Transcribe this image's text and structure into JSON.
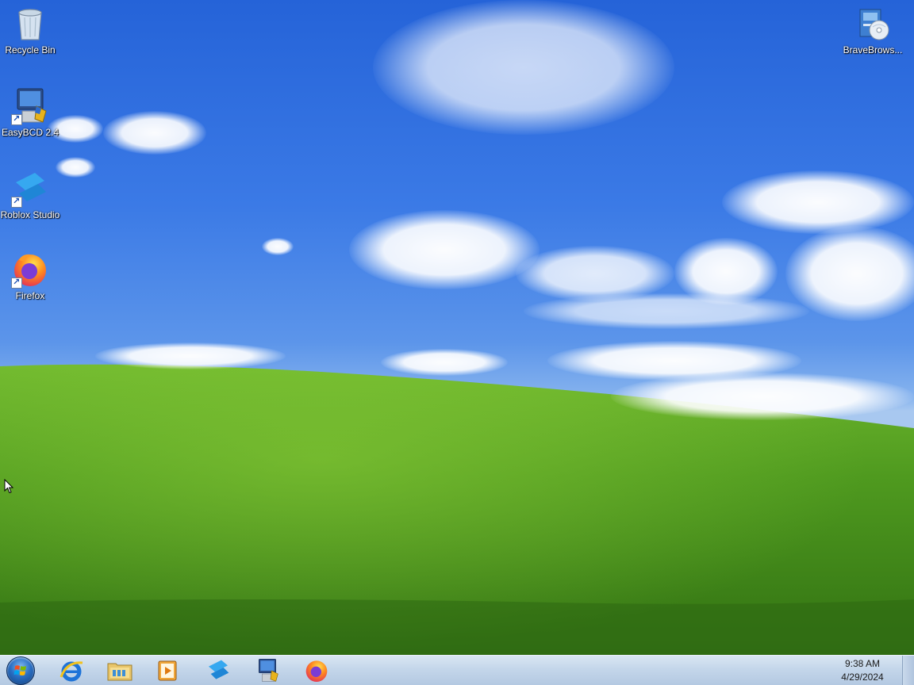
{
  "desktop": {
    "icons": [
      {
        "label": "Recycle Bin",
        "icon": "recycle-bin-icon",
        "shortcut": false
      },
      {
        "label": "EasyBCD 2.4",
        "icon": "easybcd-icon",
        "shortcut": true
      },
      {
        "label": "Roblox Studio",
        "icon": "roblox-studio-icon",
        "shortcut": true
      },
      {
        "label": "Firefox",
        "icon": "firefox-icon",
        "shortcut": true
      },
      {
        "label": "BraveBrows...",
        "icon": "brave-installer-icon",
        "shortcut": false
      }
    ]
  },
  "taskbar": {
    "pinned": [
      {
        "icon": "internet-explorer-icon"
      },
      {
        "icon": "file-explorer-icon"
      },
      {
        "icon": "media-player-icon"
      },
      {
        "icon": "roblox-studio-icon"
      },
      {
        "icon": "easybcd-icon"
      },
      {
        "icon": "firefox-icon"
      }
    ],
    "clock": {
      "time": "9:38 AM",
      "date": "4/29/2024"
    }
  },
  "colors": {
    "sky_top": "#2563d8",
    "grass": "#4f9a1f",
    "taskbar": "#c4d6ea"
  }
}
